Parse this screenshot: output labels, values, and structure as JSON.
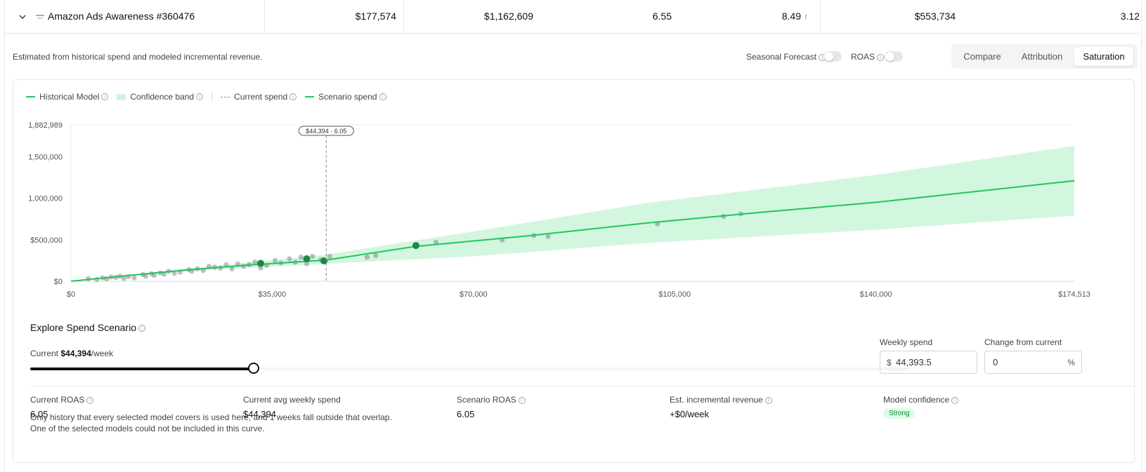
{
  "row": {
    "name": "Amazon Ads Awareness #360476",
    "logo_text": "amazon",
    "values": [
      "$177,574",
      "$1,162,609",
      "6.55",
      "8.49",
      "$553,734",
      "3.12"
    ],
    "trend_icon": "arrow-up-icon"
  },
  "subheader": {
    "estimate_text": "Estimated from historical spend and modeled incremental revenue.",
    "seasonal_label": "Seasonal Forecast",
    "roas_label": "ROAS",
    "tabs": [
      "Compare",
      "Attribution",
      "Saturation"
    ],
    "active_tab": "Saturation"
  },
  "legend": {
    "historical": "Historical Model",
    "band": "Confidence band",
    "current": "Current spend",
    "scenario": "Scenario spend"
  },
  "colors": {
    "line": "#22c55e",
    "band": "#d1f5dc",
    "point": "#1b8a3e",
    "scatter": "#6b7280"
  },
  "chart_data": {
    "type": "line",
    "x_ticks": [
      "$0",
      "$35,000",
      "$70,000",
      "$105,000",
      "$140,000",
      "$174,513"
    ],
    "y_ticks": [
      "$0",
      "$500,000",
      "1,000,000",
      "1,500,000",
      "1,882,989"
    ],
    "xlim": [
      0,
      174513
    ],
    "ylim": [
      0,
      1882989
    ],
    "grid": true,
    "current_marker_label": "$44,394 · 6.05",
    "current_spend": 44394,
    "series": [
      {
        "name": "Historical Model",
        "x": [
          0,
          10000,
          20000,
          30000,
          44394,
          60000,
          80000,
          100000,
          120000,
          140000,
          174513
        ],
        "y": [
          0,
          70000,
          135000,
          190000,
          255000,
          420000,
          550000,
          700000,
          830000,
          950000,
          1210000
        ]
      }
    ],
    "band_upper": {
      "x": [
        0,
        20000,
        44394,
        70000,
        100000,
        140000,
        174513
      ],
      "y": [
        0,
        150000,
        320000,
        600000,
        940000,
        1280000,
        1630000
      ]
    },
    "band_lower": {
      "x": [
        0,
        20000,
        44394,
        70000,
        100000,
        140000,
        174513
      ],
      "y": [
        0,
        120000,
        210000,
        300000,
        460000,
        620000,
        790000
      ]
    },
    "scatter": {
      "x": [
        3000,
        4500,
        5500,
        6200,
        7000,
        7800,
        8500,
        9200,
        10000,
        11000,
        12500,
        13000,
        14000,
        14500,
        15500,
        16200,
        17000,
        18000,
        19000,
        20500,
        21000,
        22000,
        23000,
        24000,
        25000,
        26000,
        27000,
        28000,
        29000,
        30000,
        31000,
        32000,
        33000,
        34000,
        35500,
        36500,
        38000,
        39000,
        40000,
        41000,
        42000,
        43500,
        45000,
        51500,
        53000,
        63500,
        75000,
        80500,
        83000,
        102000,
        113500,
        116500
      ],
      "y": [
        30000,
        20000,
        40000,
        30000,
        50000,
        45000,
        60000,
        35000,
        55000,
        40000,
        80000,
        60000,
        90000,
        70000,
        100000,
        85000,
        120000,
        95000,
        110000,
        140000,
        120000,
        150000,
        130000,
        180000,
        170000,
        160000,
        200000,
        150000,
        210000,
        180000,
        200000,
        230000,
        160000,
        190000,
        250000,
        220000,
        270000,
        230000,
        290000,
        210000,
        300000,
        260000,
        300000,
        290000,
        310000,
        470000,
        495000,
        550000,
        540000,
        690000,
        780000,
        810000
      ]
    },
    "highlight": {
      "x": [
        33000,
        41000,
        44000,
        60000
      ],
      "y": [
        215000,
        270000,
        245000,
        430000
      ]
    }
  },
  "explore": {
    "title": "Explore Spend Scenario",
    "current_prefix": "Current ",
    "current_value": "$44,394",
    "current_suffix": "/week",
    "slider_fraction": 0.254,
    "weekly_label": "Weekly spend",
    "weekly_prefix": "$",
    "weekly_value": "44,393.5",
    "change_label": "Change from current",
    "change_value": "0",
    "change_suffix": "%"
  },
  "stats": {
    "current_roas_label": "Current ROAS",
    "current_roas": "6.05",
    "avg_spend_label": "Current avg weekly spend",
    "avg_spend": "$44,394",
    "scenario_roas_label": "Scenario ROAS",
    "scenario_roas": "6.05",
    "incremental_label": "Est. incremental revenue",
    "incremental": "+$0/week",
    "confidence_label": "Model confidence",
    "confidence": "Strong"
  },
  "notes": {
    "line1": "Only history that every selected model covers is used here, and 1 weeks fall outside that overlap.",
    "line2": "One of the selected models could not be included in this curve."
  }
}
